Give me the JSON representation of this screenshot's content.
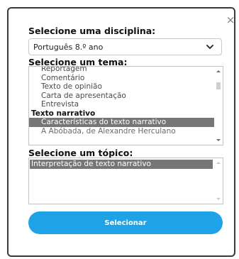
{
  "dialog": {
    "close_label": "×",
    "discipline": {
      "heading": "Selecione uma disciplina:",
      "selected": "Português 8.º ano"
    },
    "theme": {
      "heading": "Selecione um tema:",
      "options": [
        {
          "label": "Reportagem",
          "kind": "option",
          "state": "partially-visible"
        },
        {
          "label": "Comentário",
          "kind": "option"
        },
        {
          "label": "Texto de opinião",
          "kind": "option"
        },
        {
          "label": "Carta de apresentação",
          "kind": "option"
        },
        {
          "label": "Entrevista",
          "kind": "option"
        },
        {
          "label": "Texto narrativo",
          "kind": "group"
        },
        {
          "label": "Características do texto narrativo",
          "kind": "option",
          "state": "selected"
        },
        {
          "label": "A Abóbada, de Alexandre Herculano",
          "kind": "option",
          "state": "partially-visible"
        }
      ]
    },
    "topic": {
      "heading": "Selecione um tópico:",
      "options": [
        {
          "label": "Interpretação de texto narrativo",
          "state": "selected"
        }
      ]
    },
    "submit_label": "Selecionar"
  },
  "colors": {
    "accent": "#1ea3e6",
    "selection": "#767676",
    "frame_border": "#3a3a3a"
  },
  "icons": {
    "close": "close-icon",
    "dropdown": "chevron-down-icon",
    "scroll_up": "scroll-up-arrow-icon",
    "scroll_down": "scroll-down-arrow-icon"
  }
}
